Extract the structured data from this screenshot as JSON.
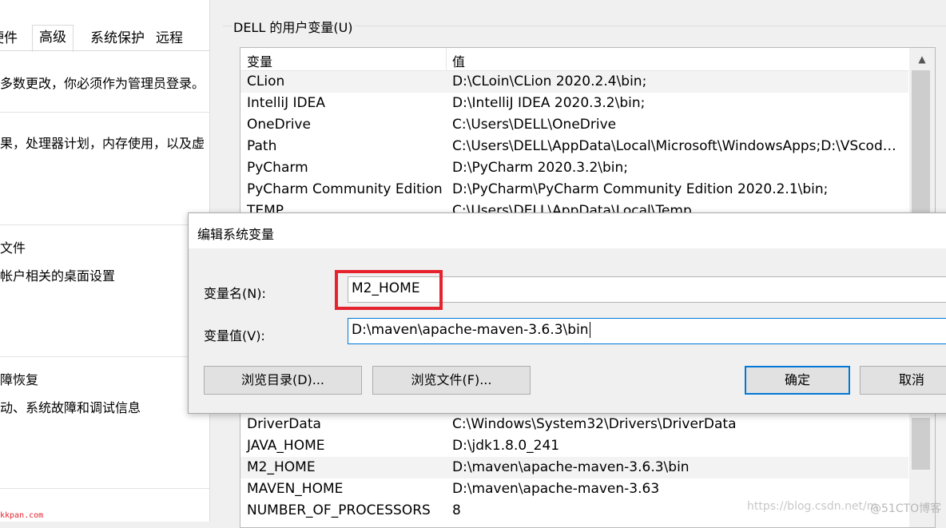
{
  "left_window": {
    "tabs": [
      "硬件",
      "高级",
      "系统保护",
      "远程"
    ],
    "text_admin": "多数更改，你必须作为管理员登录。",
    "text_perf": "果，处理器计划，内存使用，以及虚",
    "heading_profile": "文件",
    "text_profile": "帐户相关的桌面设置",
    "heading_recovery": "障恢复",
    "text_recovery": "动、系统故障和调试信息"
  },
  "env_window": {
    "group_label": "DELL 的用户变量(U)",
    "columns": {
      "name": "变量",
      "value": "值"
    },
    "rows_top": [
      {
        "name": "CLion",
        "value": "D:\\CLoin\\CLion 2020.2.4\\bin;"
      },
      {
        "name": "IntelliJ IDEA",
        "value": "D:\\IntelliJ IDEA 2020.3.2\\bin;"
      },
      {
        "name": "OneDrive",
        "value": "C:\\Users\\DELL\\OneDrive"
      },
      {
        "name": "Path",
        "value": "C:\\Users\\DELL\\AppData\\Local\\Microsoft\\WindowsApps;D:\\VScode..."
      },
      {
        "name": "PyCharm",
        "value": "D:\\PyCharm 2020.3.2\\bin;"
      },
      {
        "name": "PyCharm Community Edition",
        "value": "D:\\PyCharm\\PyCharm Community Edition 2020.2.1\\bin;"
      },
      {
        "name": "TEMP",
        "value": "C:\\Users\\DELL\\AppData\\Local\\Temp"
      }
    ],
    "rows_bottom": [
      {
        "name": "DriverData",
        "value": "C:\\Windows\\System32\\Drivers\\DriverData"
      },
      {
        "name": "JAVA_HOME",
        "value": "D:\\jdk1.8.0_241"
      },
      {
        "name": "M2_HOME",
        "value": "D:\\maven\\apache-maven-3.6.3\\bin"
      },
      {
        "name": "MAVEN_HOME",
        "value": "D:\\maven\\apache-maven-3.63"
      },
      {
        "name": "NUMBER_OF_PROCESSORS",
        "value": "8"
      }
    ]
  },
  "dialog": {
    "title": "编辑系统变量",
    "name_label": "变量名(N):",
    "name_value": "M2_HOME",
    "value_label": "变量值(V):",
    "value_value": "D:\\maven\\apache-maven-3.6.3\\bin",
    "browse_dir_label": "浏览目录(D)...",
    "browse_file_label": "浏览文件(F)...",
    "ok_label": "确定",
    "cancel_label": "取消"
  },
  "watermarks": {
    "csdn": "https://blog.csdn.net/m",
    "cto": "@51CTO博客",
    "kkpan": "kkpan.com"
  },
  "colors": {
    "highlight": "#e5232f",
    "focus": "#0078d7"
  }
}
